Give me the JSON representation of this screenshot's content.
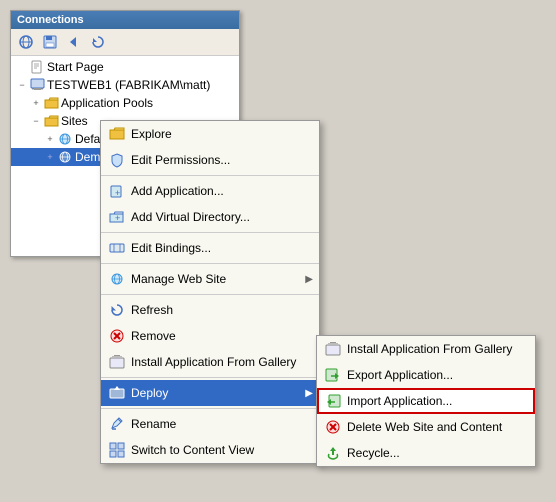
{
  "panel": {
    "title": "Connections",
    "toolbar": {
      "back_label": "◀",
      "forward_label": "▶",
      "up_label": "⬆",
      "home_label": "⌂"
    }
  },
  "tree": {
    "items": [
      {
        "id": "start-page",
        "label": "Start Page",
        "level": 0,
        "icon": "page",
        "expanded": false,
        "selected": false
      },
      {
        "id": "server",
        "label": "TESTWEB1 (FABRIKAM\\matt)",
        "level": 0,
        "icon": "computer",
        "expanded": true,
        "selected": false
      },
      {
        "id": "app-pools",
        "label": "Application Pools",
        "level": 1,
        "icon": "folder",
        "expanded": false,
        "selected": false
      },
      {
        "id": "sites",
        "label": "Sites",
        "level": 1,
        "icon": "folder",
        "expanded": true,
        "selected": false
      },
      {
        "id": "default-web",
        "label": "Default Web Site",
        "level": 2,
        "icon": "globe",
        "expanded": false,
        "selected": false
      },
      {
        "id": "demosite",
        "label": "DemoSite",
        "level": 2,
        "icon": "site",
        "expanded": false,
        "selected": true
      }
    ]
  },
  "context_menu": {
    "items": [
      {
        "id": "explore",
        "label": "Explore",
        "icon": "folder",
        "has_submenu": false,
        "divider_after": false
      },
      {
        "id": "edit-permissions",
        "label": "Edit Permissions...",
        "icon": "shield",
        "has_submenu": false,
        "divider_after": true
      },
      {
        "id": "add-application",
        "label": "Add Application...",
        "icon": "add-app",
        "has_submenu": false,
        "divider_after": false
      },
      {
        "id": "add-virtual-dir",
        "label": "Add Virtual Directory...",
        "icon": "add-dir",
        "has_submenu": false,
        "divider_after": true
      },
      {
        "id": "edit-bindings",
        "label": "Edit Bindings...",
        "icon": "binding",
        "has_submenu": false,
        "divider_after": true
      },
      {
        "id": "manage-website",
        "label": "Manage Web Site",
        "icon": "manage",
        "has_submenu": true,
        "divider_after": true
      },
      {
        "id": "refresh",
        "label": "Refresh",
        "icon": "refresh",
        "has_submenu": false,
        "divider_after": false
      },
      {
        "id": "remove",
        "label": "Remove",
        "icon": "remove",
        "has_submenu": false,
        "divider_after": false
      },
      {
        "id": "install-gallery",
        "label": "Install Application From Gallery",
        "icon": "gallery",
        "has_submenu": false,
        "divider_after": true
      },
      {
        "id": "deploy",
        "label": "Deploy",
        "icon": "deploy",
        "has_submenu": true,
        "divider_after": true,
        "active": true
      },
      {
        "id": "rename",
        "label": "Rename",
        "icon": "rename",
        "has_submenu": false,
        "divider_after": false
      },
      {
        "id": "switch-content",
        "label": "Switch to Content View",
        "icon": "switch",
        "has_submenu": false,
        "divider_after": false
      }
    ]
  },
  "submenu": {
    "items": [
      {
        "id": "install-gallery-sub",
        "label": "Install Application From Gallery",
        "icon": "gallery"
      },
      {
        "id": "export-app",
        "label": "Export Application...",
        "icon": "export"
      },
      {
        "id": "import-app",
        "label": "Import Application...",
        "icon": "import",
        "highlighted": true
      },
      {
        "id": "delete-website",
        "label": "Delete Web Site and Content",
        "icon": "delete"
      },
      {
        "id": "recycle",
        "label": "Recycle...",
        "icon": "recycle"
      }
    ]
  }
}
